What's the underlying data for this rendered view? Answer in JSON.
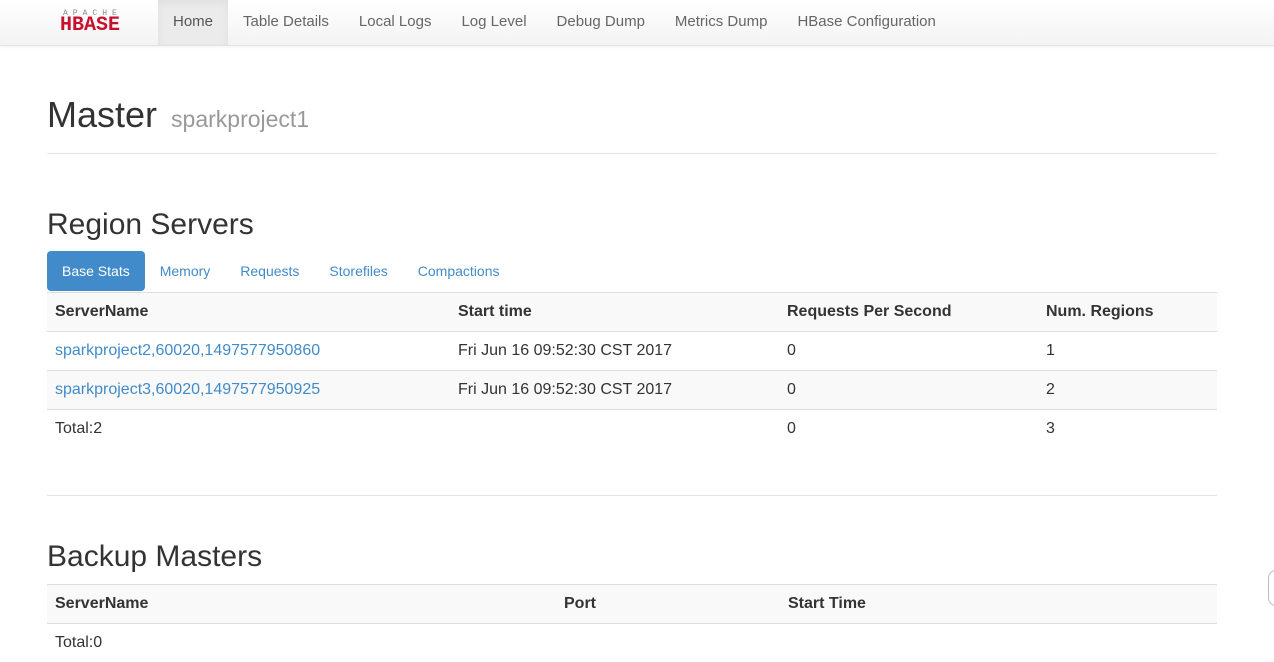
{
  "brand": {
    "top": "APACHE",
    "name": "HBASE"
  },
  "nav": {
    "items": [
      {
        "label": "Home"
      },
      {
        "label": "Table Details"
      },
      {
        "label": "Local Logs"
      },
      {
        "label": "Log Level"
      },
      {
        "label": "Debug Dump"
      },
      {
        "label": "Metrics Dump"
      },
      {
        "label": "HBase Configuration"
      }
    ]
  },
  "header": {
    "title": "Master",
    "host": "sparkproject1"
  },
  "region_servers": {
    "title": "Region Servers",
    "tabs": [
      "Base Stats",
      "Memory",
      "Requests",
      "Storefiles",
      "Compactions"
    ],
    "columns": [
      "ServerName",
      "Start time",
      "Requests Per Second",
      "Num. Regions"
    ],
    "rows": [
      {
        "server": "sparkproject2,60020,1497577950860",
        "start": "Fri Jun 16 09:52:30 CST 2017",
        "rps": "0",
        "regions": "1"
      },
      {
        "server": "sparkproject3,60020,1497577950925",
        "start": "Fri Jun 16 09:52:30 CST 2017",
        "rps": "0",
        "regions": "2"
      }
    ],
    "total": {
      "label": "Total:2",
      "rps": "0",
      "regions": "3"
    }
  },
  "backup_masters": {
    "title": "Backup Masters",
    "columns": [
      "ServerName",
      "Port",
      "Start Time"
    ],
    "total": "Total:0"
  }
}
